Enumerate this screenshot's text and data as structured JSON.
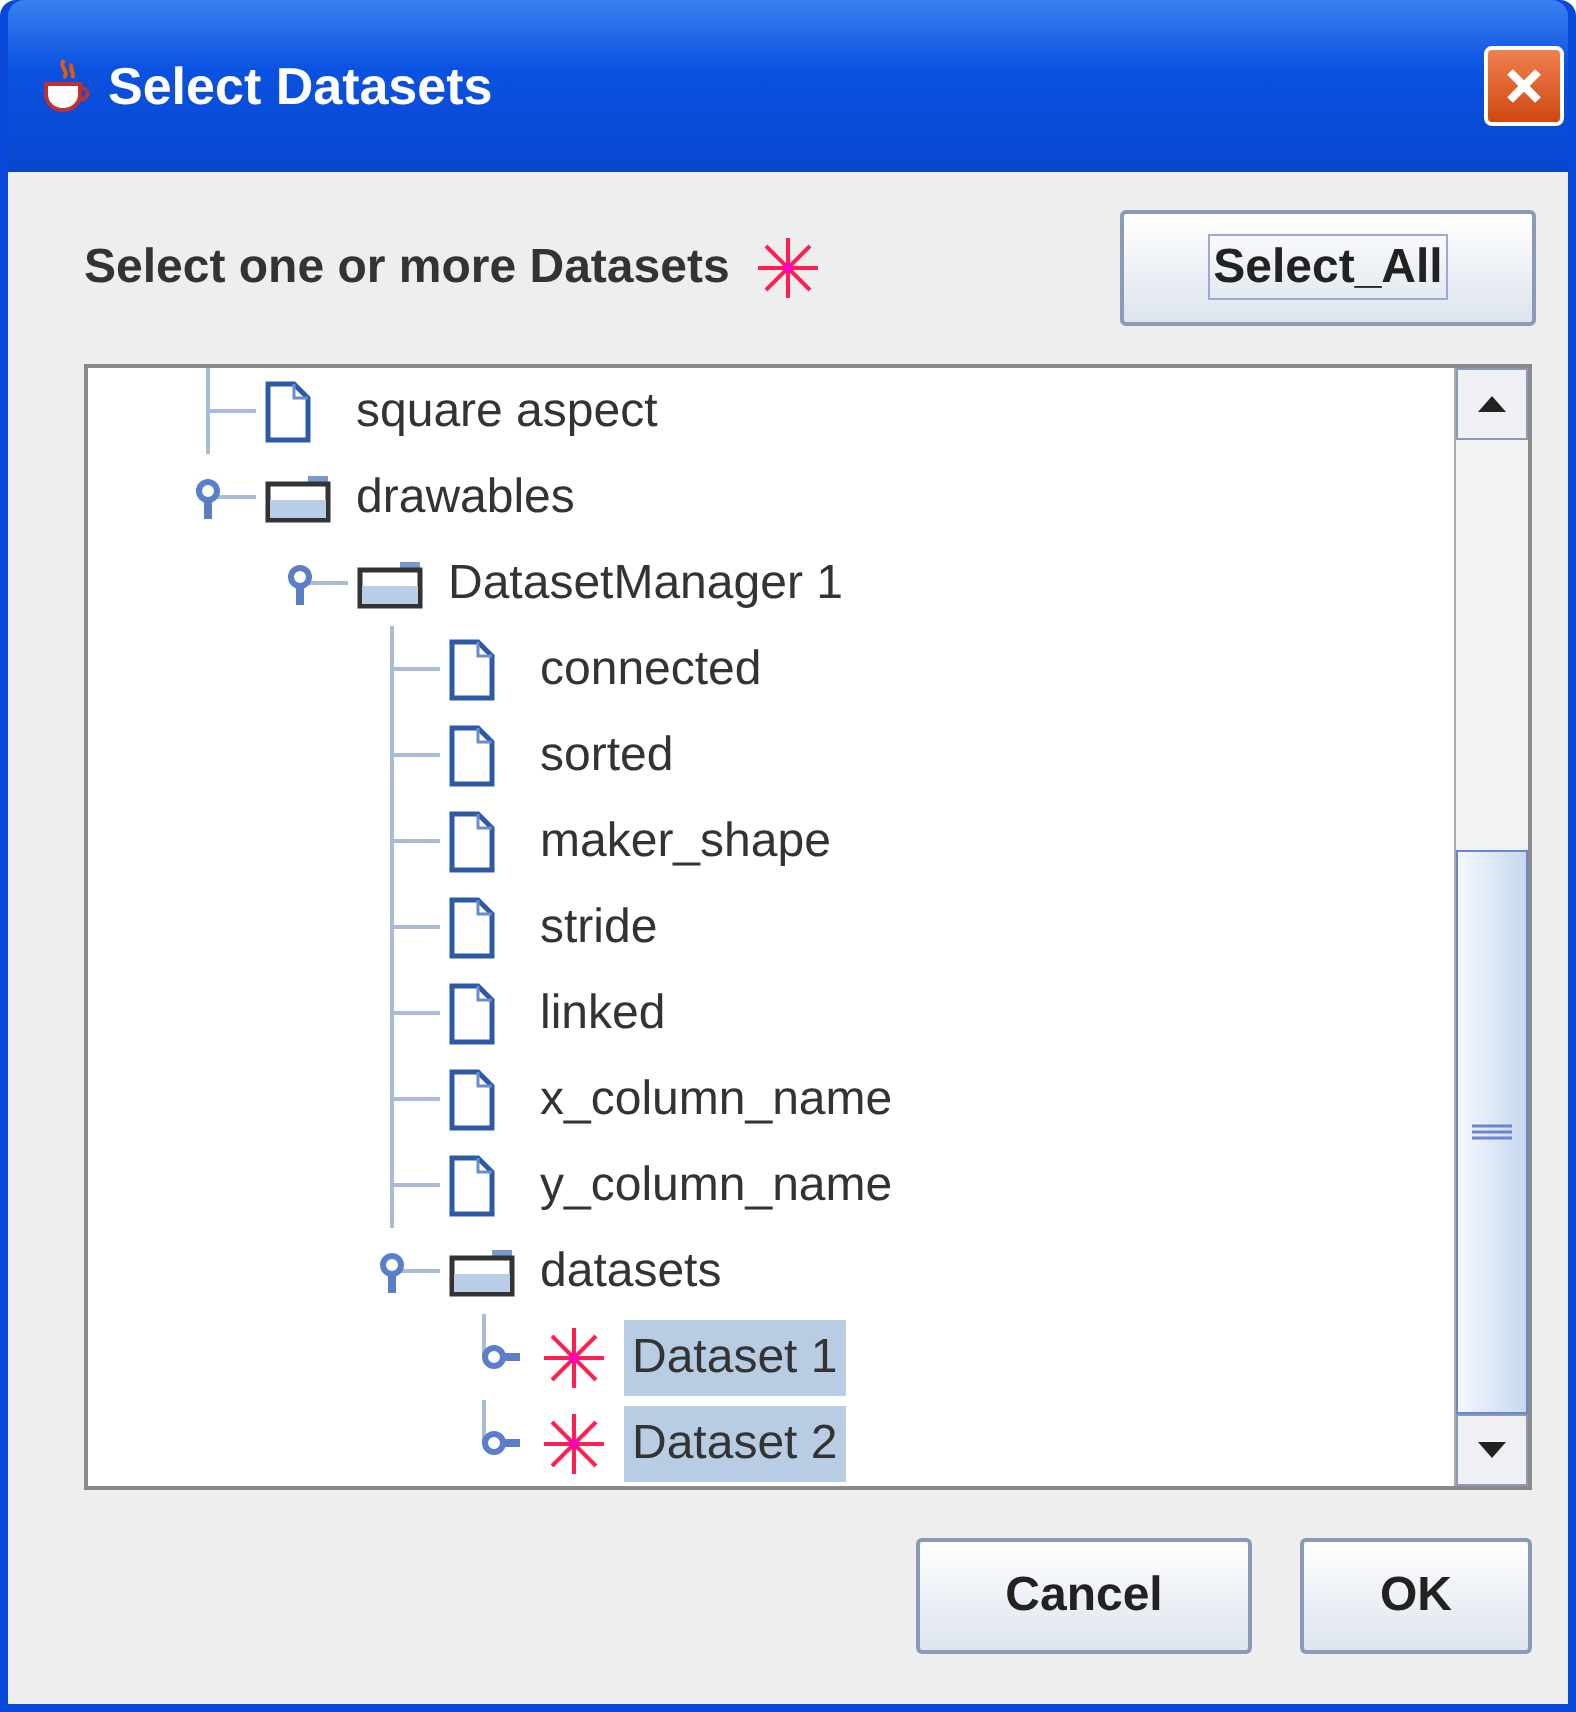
{
  "window": {
    "title": "Select Datasets"
  },
  "prompt": "Select one or more Datasets",
  "select_all_button": "Select_All",
  "tree": [
    {
      "label": "square aspect",
      "kind": "leaf",
      "selected": false
    },
    {
      "label": "drawables",
      "kind": "folder",
      "selected": false,
      "expanded": true,
      "children": [
        {
          "label": "DatasetManager 1",
          "kind": "folder",
          "selected": false,
          "expanded": true,
          "children": [
            {
              "label": "connected",
              "kind": "leaf",
              "selected": false
            },
            {
              "label": "sorted",
              "kind": "leaf",
              "selected": false
            },
            {
              "label": "maker_shape",
              "kind": "leaf",
              "selected": false
            },
            {
              "label": "stride",
              "kind": "leaf",
              "selected": false
            },
            {
              "label": "linked",
              "kind": "leaf",
              "selected": false
            },
            {
              "label": "x_column_name",
              "kind": "leaf",
              "selected": false
            },
            {
              "label": "y_column_name",
              "kind": "leaf",
              "selected": false
            },
            {
              "label": "datasets",
              "kind": "folder",
              "selected": false,
              "expanded": true,
              "children": [
                {
                  "label": "Dataset 1",
                  "kind": "dataset",
                  "selected": true,
                  "expanded": false
                },
                {
                  "label": "Dataset 2",
                  "kind": "dataset",
                  "selected": true,
                  "expanded": false
                }
              ]
            }
          ]
        }
      ]
    }
  ],
  "buttons": [
    "Cancel",
    "OK"
  ]
}
